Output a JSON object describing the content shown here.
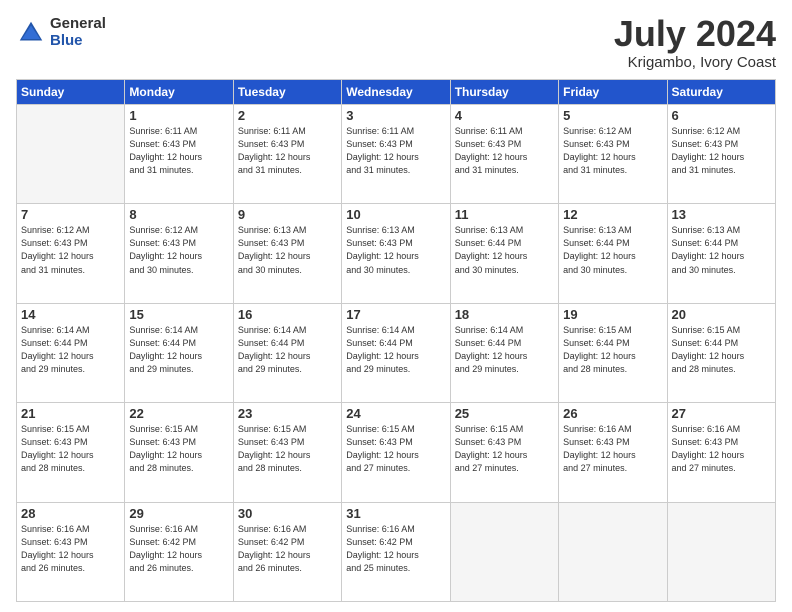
{
  "header": {
    "logo_general": "General",
    "logo_blue": "Blue",
    "title": "July 2024",
    "location": "Krigambo, Ivory Coast"
  },
  "days_of_week": [
    "Sunday",
    "Monday",
    "Tuesday",
    "Wednesday",
    "Thursday",
    "Friday",
    "Saturday"
  ],
  "weeks": [
    [
      {
        "day": "",
        "info": ""
      },
      {
        "day": "1",
        "info": "Sunrise: 6:11 AM\nSunset: 6:43 PM\nDaylight: 12 hours\nand 31 minutes."
      },
      {
        "day": "2",
        "info": "Sunrise: 6:11 AM\nSunset: 6:43 PM\nDaylight: 12 hours\nand 31 minutes."
      },
      {
        "day": "3",
        "info": "Sunrise: 6:11 AM\nSunset: 6:43 PM\nDaylight: 12 hours\nand 31 minutes."
      },
      {
        "day": "4",
        "info": "Sunrise: 6:11 AM\nSunset: 6:43 PM\nDaylight: 12 hours\nand 31 minutes."
      },
      {
        "day": "5",
        "info": "Sunrise: 6:12 AM\nSunset: 6:43 PM\nDaylight: 12 hours\nand 31 minutes."
      },
      {
        "day": "6",
        "info": "Sunrise: 6:12 AM\nSunset: 6:43 PM\nDaylight: 12 hours\nand 31 minutes."
      }
    ],
    [
      {
        "day": "7",
        "info": "Sunrise: 6:12 AM\nSunset: 6:43 PM\nDaylight: 12 hours\nand 31 minutes."
      },
      {
        "day": "8",
        "info": "Sunrise: 6:12 AM\nSunset: 6:43 PM\nDaylight: 12 hours\nand 30 minutes."
      },
      {
        "day": "9",
        "info": "Sunrise: 6:13 AM\nSunset: 6:43 PM\nDaylight: 12 hours\nand 30 minutes."
      },
      {
        "day": "10",
        "info": "Sunrise: 6:13 AM\nSunset: 6:43 PM\nDaylight: 12 hours\nand 30 minutes."
      },
      {
        "day": "11",
        "info": "Sunrise: 6:13 AM\nSunset: 6:44 PM\nDaylight: 12 hours\nand 30 minutes."
      },
      {
        "day": "12",
        "info": "Sunrise: 6:13 AM\nSunset: 6:44 PM\nDaylight: 12 hours\nand 30 minutes."
      },
      {
        "day": "13",
        "info": "Sunrise: 6:13 AM\nSunset: 6:44 PM\nDaylight: 12 hours\nand 30 minutes."
      }
    ],
    [
      {
        "day": "14",
        "info": "Sunrise: 6:14 AM\nSunset: 6:44 PM\nDaylight: 12 hours\nand 29 minutes."
      },
      {
        "day": "15",
        "info": "Sunrise: 6:14 AM\nSunset: 6:44 PM\nDaylight: 12 hours\nand 29 minutes."
      },
      {
        "day": "16",
        "info": "Sunrise: 6:14 AM\nSunset: 6:44 PM\nDaylight: 12 hours\nand 29 minutes."
      },
      {
        "day": "17",
        "info": "Sunrise: 6:14 AM\nSunset: 6:44 PM\nDaylight: 12 hours\nand 29 minutes."
      },
      {
        "day": "18",
        "info": "Sunrise: 6:14 AM\nSunset: 6:44 PM\nDaylight: 12 hours\nand 29 minutes."
      },
      {
        "day": "19",
        "info": "Sunrise: 6:15 AM\nSunset: 6:44 PM\nDaylight: 12 hours\nand 28 minutes."
      },
      {
        "day": "20",
        "info": "Sunrise: 6:15 AM\nSunset: 6:44 PM\nDaylight: 12 hours\nand 28 minutes."
      }
    ],
    [
      {
        "day": "21",
        "info": "Sunrise: 6:15 AM\nSunset: 6:43 PM\nDaylight: 12 hours\nand 28 minutes."
      },
      {
        "day": "22",
        "info": "Sunrise: 6:15 AM\nSunset: 6:43 PM\nDaylight: 12 hours\nand 28 minutes."
      },
      {
        "day": "23",
        "info": "Sunrise: 6:15 AM\nSunset: 6:43 PM\nDaylight: 12 hours\nand 28 minutes."
      },
      {
        "day": "24",
        "info": "Sunrise: 6:15 AM\nSunset: 6:43 PM\nDaylight: 12 hours\nand 27 minutes."
      },
      {
        "day": "25",
        "info": "Sunrise: 6:15 AM\nSunset: 6:43 PM\nDaylight: 12 hours\nand 27 minutes."
      },
      {
        "day": "26",
        "info": "Sunrise: 6:16 AM\nSunset: 6:43 PM\nDaylight: 12 hours\nand 27 minutes."
      },
      {
        "day": "27",
        "info": "Sunrise: 6:16 AM\nSunset: 6:43 PM\nDaylight: 12 hours\nand 27 minutes."
      }
    ],
    [
      {
        "day": "28",
        "info": "Sunrise: 6:16 AM\nSunset: 6:43 PM\nDaylight: 12 hours\nand 26 minutes."
      },
      {
        "day": "29",
        "info": "Sunrise: 6:16 AM\nSunset: 6:42 PM\nDaylight: 12 hours\nand 26 minutes."
      },
      {
        "day": "30",
        "info": "Sunrise: 6:16 AM\nSunset: 6:42 PM\nDaylight: 12 hours\nand 26 minutes."
      },
      {
        "day": "31",
        "info": "Sunrise: 6:16 AM\nSunset: 6:42 PM\nDaylight: 12 hours\nand 25 minutes."
      },
      {
        "day": "",
        "info": ""
      },
      {
        "day": "",
        "info": ""
      },
      {
        "day": "",
        "info": ""
      }
    ]
  ]
}
